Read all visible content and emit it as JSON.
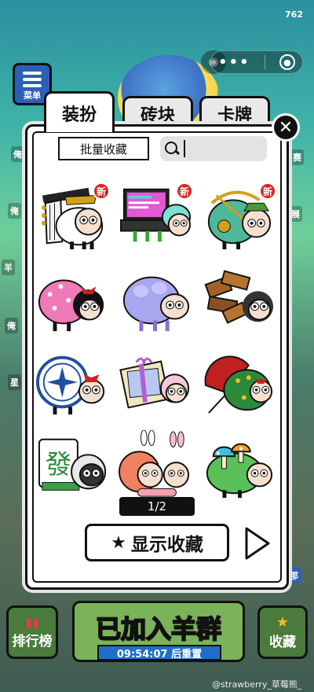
{
  "status": {
    "number": "762"
  },
  "background": {
    "menu_label": "菜单"
  },
  "tabs": [
    {
      "label": "装扮"
    },
    {
      "label": "砖块"
    },
    {
      "label": "卡牌"
    }
  ],
  "toolbar": {
    "batch_label": "批量收藏",
    "search_value": ""
  },
  "items": [
    {
      "name": "emperor-sheep",
      "new": "新"
    },
    {
      "name": "computer-sheep",
      "new": "新"
    },
    {
      "name": "archer-sheep",
      "new": "新"
    },
    {
      "name": "pink-wool-sheep",
      "new": ""
    },
    {
      "name": "lavender-sheep",
      "new": ""
    },
    {
      "name": "wood-block-sheep",
      "new": ""
    },
    {
      "name": "porcelain-plate-sheep",
      "new": ""
    },
    {
      "name": "gift-box-sheep",
      "new": ""
    },
    {
      "name": "umbrella-sheep",
      "new": ""
    },
    {
      "name": "mahjong-fa-sheep",
      "new": "",
      "tile_text": "發"
    },
    {
      "name": "bunny-twins-sheep",
      "new": ""
    },
    {
      "name": "mushroom-sheep",
      "new": ""
    }
  ],
  "pager": {
    "text": "1/2"
  },
  "show_fav": {
    "label": "显示收藏"
  },
  "bottom": {
    "rank_label": "排行榜",
    "join_label": "已加入羊群",
    "timer": "09:54:07 后重置",
    "fav_label": "收藏"
  },
  "watermark": "@strawberry_草莓熊_",
  "colors": {
    "badge": "#e02020",
    "timer_bg": "#1f6fc8",
    "panel": "#ffffff"
  }
}
